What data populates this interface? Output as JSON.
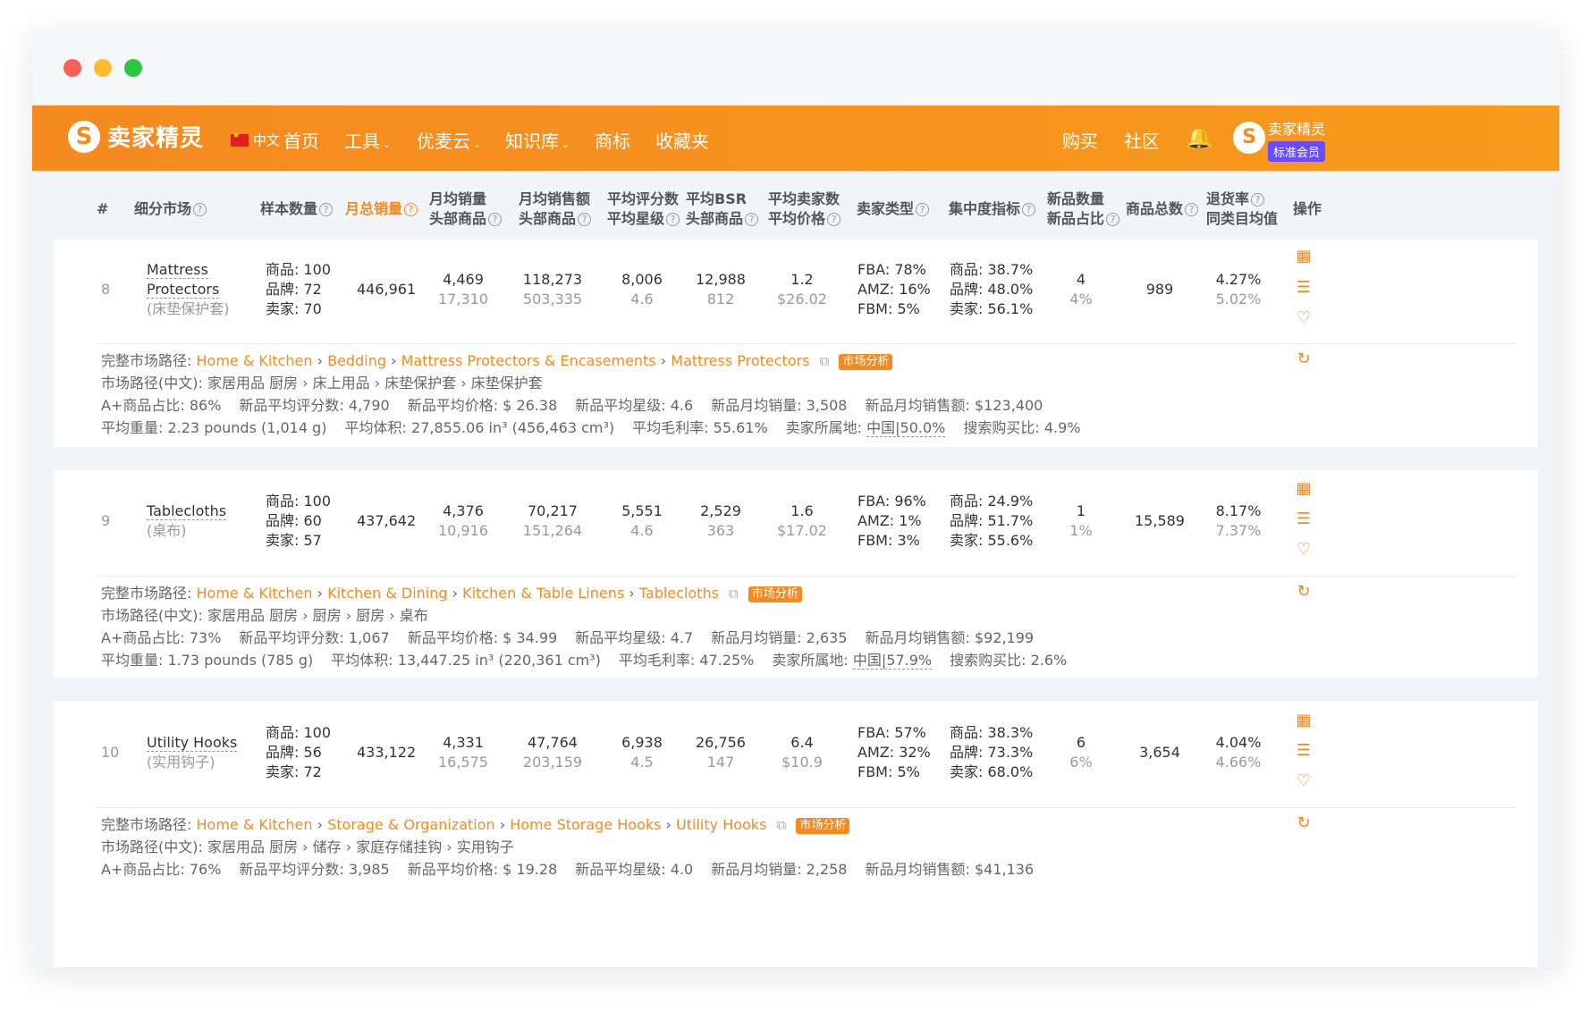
{
  "nav": {
    "logo_text": "卖家精灵",
    "logo_mark": "S",
    "lang": "中文",
    "items": [
      "首页",
      "工具",
      "优麦云",
      "知识库",
      "商标",
      "收藏夹"
    ],
    "right_items": [
      "购买",
      "社区"
    ],
    "user_name": "卖家精灵",
    "user_badge": "标准会员"
  },
  "colors": {
    "brand": "#f58a1f",
    "badge": "#6a4cff"
  },
  "headers": {
    "index": "#",
    "market": "细分市场",
    "samples": "样本数量",
    "monthly_sales": "月总销量",
    "avg_sales_l1": "月均销量",
    "avg_sales_l2": "头部商品",
    "avg_revenue_l1": "月均销售额",
    "avg_revenue_l2": "头部商品",
    "avg_reviews_l1": "平均评分数",
    "avg_reviews_l2": "平均星级",
    "avg_bsr_l1": "平均BSR",
    "avg_bsr_l2": "头部商品",
    "avg_sellers_l1": "平均卖家数",
    "avg_sellers_l2": "平均价格",
    "seller_type": "卖家类型",
    "concentration": "集中度指标",
    "new_l1": "新品数量",
    "new_l2": "新品占比",
    "total": "商品总数",
    "return_l1": "退货率",
    "return_l2": "同类目均值",
    "ops": "操作"
  },
  "rows": [
    {
      "idx": "8",
      "name_line1": "Mattress",
      "name_line2": "Protectors",
      "name_cn": "(床垫保护套)",
      "samples": [
        "商品: 100",
        "品牌: 72",
        "卖家: 70"
      ],
      "monthly_sales": "446,961",
      "avg_sales": "4,469",
      "avg_sales_top": "17,310",
      "avg_rev": "118,273",
      "avg_rev_top": "503,335",
      "reviews": "8,006",
      "rating": "4.6",
      "bsr": "12,988",
      "bsr_top": "812",
      "sellers": "1.2",
      "price": "$26.02",
      "seller_type": [
        "FBA: 78%",
        "AMZ: 16%",
        "FBM: 5%"
      ],
      "concentration": [
        "商品: 38.7%",
        "品牌: 48.0%",
        "卖家: 56.1%"
      ],
      "new_count": "4",
      "new_pct": "4%",
      "total": "989",
      "return_rate": "4.27%",
      "return_avg": "5.02%",
      "path_label": "完整市场路径:",
      "path": [
        "Home & Kitchen",
        "Bedding",
        "Mattress Protectors & Encasements",
        "Mattress Protectors"
      ],
      "tag": "市场分析",
      "path_cn_label": "市场路径(中文):",
      "path_cn": "家居用品 厨房 › 床上用品 › 床垫保护套 › 床垫保护套",
      "stats1": [
        "A+商品占比: 86%",
        "新品平均评分数: 4,790",
        "新品平均价格: $ 26.38",
        "新品平均星级: 4.6",
        "新品月均销量: 3,508",
        "新品月均销售额: $123,400"
      ],
      "stats2": [
        "平均重量: 2.23 pounds (1,014 g)",
        "平均体积: 27,855.06 in³ (456,463 cm³)",
        "平均毛利率: 55.61%"
      ],
      "seller_loc_label": "卖家所属地:",
      "seller_loc": "中国|50.0%",
      "search_buy": "搜索购买比: 4.9%"
    },
    {
      "idx": "9",
      "name_line1": "Tablecloths",
      "name_line2": "",
      "name_cn": "(桌布)",
      "samples": [
        "商品: 100",
        "品牌: 60",
        "卖家: 57"
      ],
      "monthly_sales": "437,642",
      "avg_sales": "4,376",
      "avg_sales_top": "10,916",
      "avg_rev": "70,217",
      "avg_rev_top": "151,264",
      "reviews": "5,551",
      "rating": "4.6",
      "bsr": "2,529",
      "bsr_top": "363",
      "sellers": "1.6",
      "price": "$17.02",
      "seller_type": [
        "FBA: 96%",
        "AMZ: 1%",
        "FBM: 3%"
      ],
      "concentration": [
        "商品: 24.9%",
        "品牌: 51.7%",
        "卖家: 55.6%"
      ],
      "new_count": "1",
      "new_pct": "1%",
      "total": "15,589",
      "return_rate": "8.17%",
      "return_avg": "7.37%",
      "path_label": "完整市场路径:",
      "path": [
        "Home & Kitchen",
        "Kitchen & Dining",
        "Kitchen & Table Linens",
        "Tablecloths"
      ],
      "tag": "市场分析",
      "path_cn_label": "市场路径(中文):",
      "path_cn": "家居用品 厨房 › 厨房 › 厨房 › 桌布",
      "stats1": [
        "A+商品占比: 73%",
        "新品平均评分数: 1,067",
        "新品平均价格: $ 34.99",
        "新品平均星级: 4.7",
        "新品月均销量: 2,635",
        "新品月均销售额: $92,199"
      ],
      "stats2": [
        "平均重量: 1.73 pounds (785 g)",
        "平均体积: 13,447.25 in³ (220,361 cm³)",
        "平均毛利率: 47.25%"
      ],
      "seller_loc_label": "卖家所属地:",
      "seller_loc": "中国|57.9%",
      "search_buy": "搜索购买比: 2.6%"
    },
    {
      "idx": "10",
      "name_line1": "Utility Hooks",
      "name_line2": "",
      "name_cn": "(实用钩子)",
      "samples": [
        "商品: 100",
        "品牌: 56",
        "卖家: 72"
      ],
      "monthly_sales": "433,122",
      "avg_sales": "4,331",
      "avg_sales_top": "16,575",
      "avg_rev": "47,764",
      "avg_rev_top": "203,159",
      "reviews": "6,938",
      "rating": "4.5",
      "bsr": "26,756",
      "bsr_top": "147",
      "sellers": "6.4",
      "price": "$10.9",
      "seller_type": [
        "FBA: 57%",
        "AMZ: 32%",
        "FBM: 5%"
      ],
      "concentration": [
        "商品: 38.3%",
        "品牌: 73.3%",
        "卖家: 68.0%"
      ],
      "new_count": "6",
      "new_pct": "6%",
      "total": "3,654",
      "return_rate": "4.04%",
      "return_avg": "4.66%",
      "path_label": "完整市场路径:",
      "path": [
        "Home & Kitchen",
        "Storage & Organization",
        "Home Storage Hooks",
        "Utility Hooks"
      ],
      "tag": "市场分析",
      "path_cn_label": "市场路径(中文):",
      "path_cn": "家居用品 厨房 › 储存 › 家庭存储挂钩 › 实用钩子",
      "stats1": [
        "A+商品占比: 76%",
        "新品平均评分数: 3,985",
        "新品平均价格: $ 19.28",
        "新品平均星级: 4.0",
        "新品月均销量: 2,258",
        "新品月均销售额: $41,136"
      ]
    }
  ]
}
